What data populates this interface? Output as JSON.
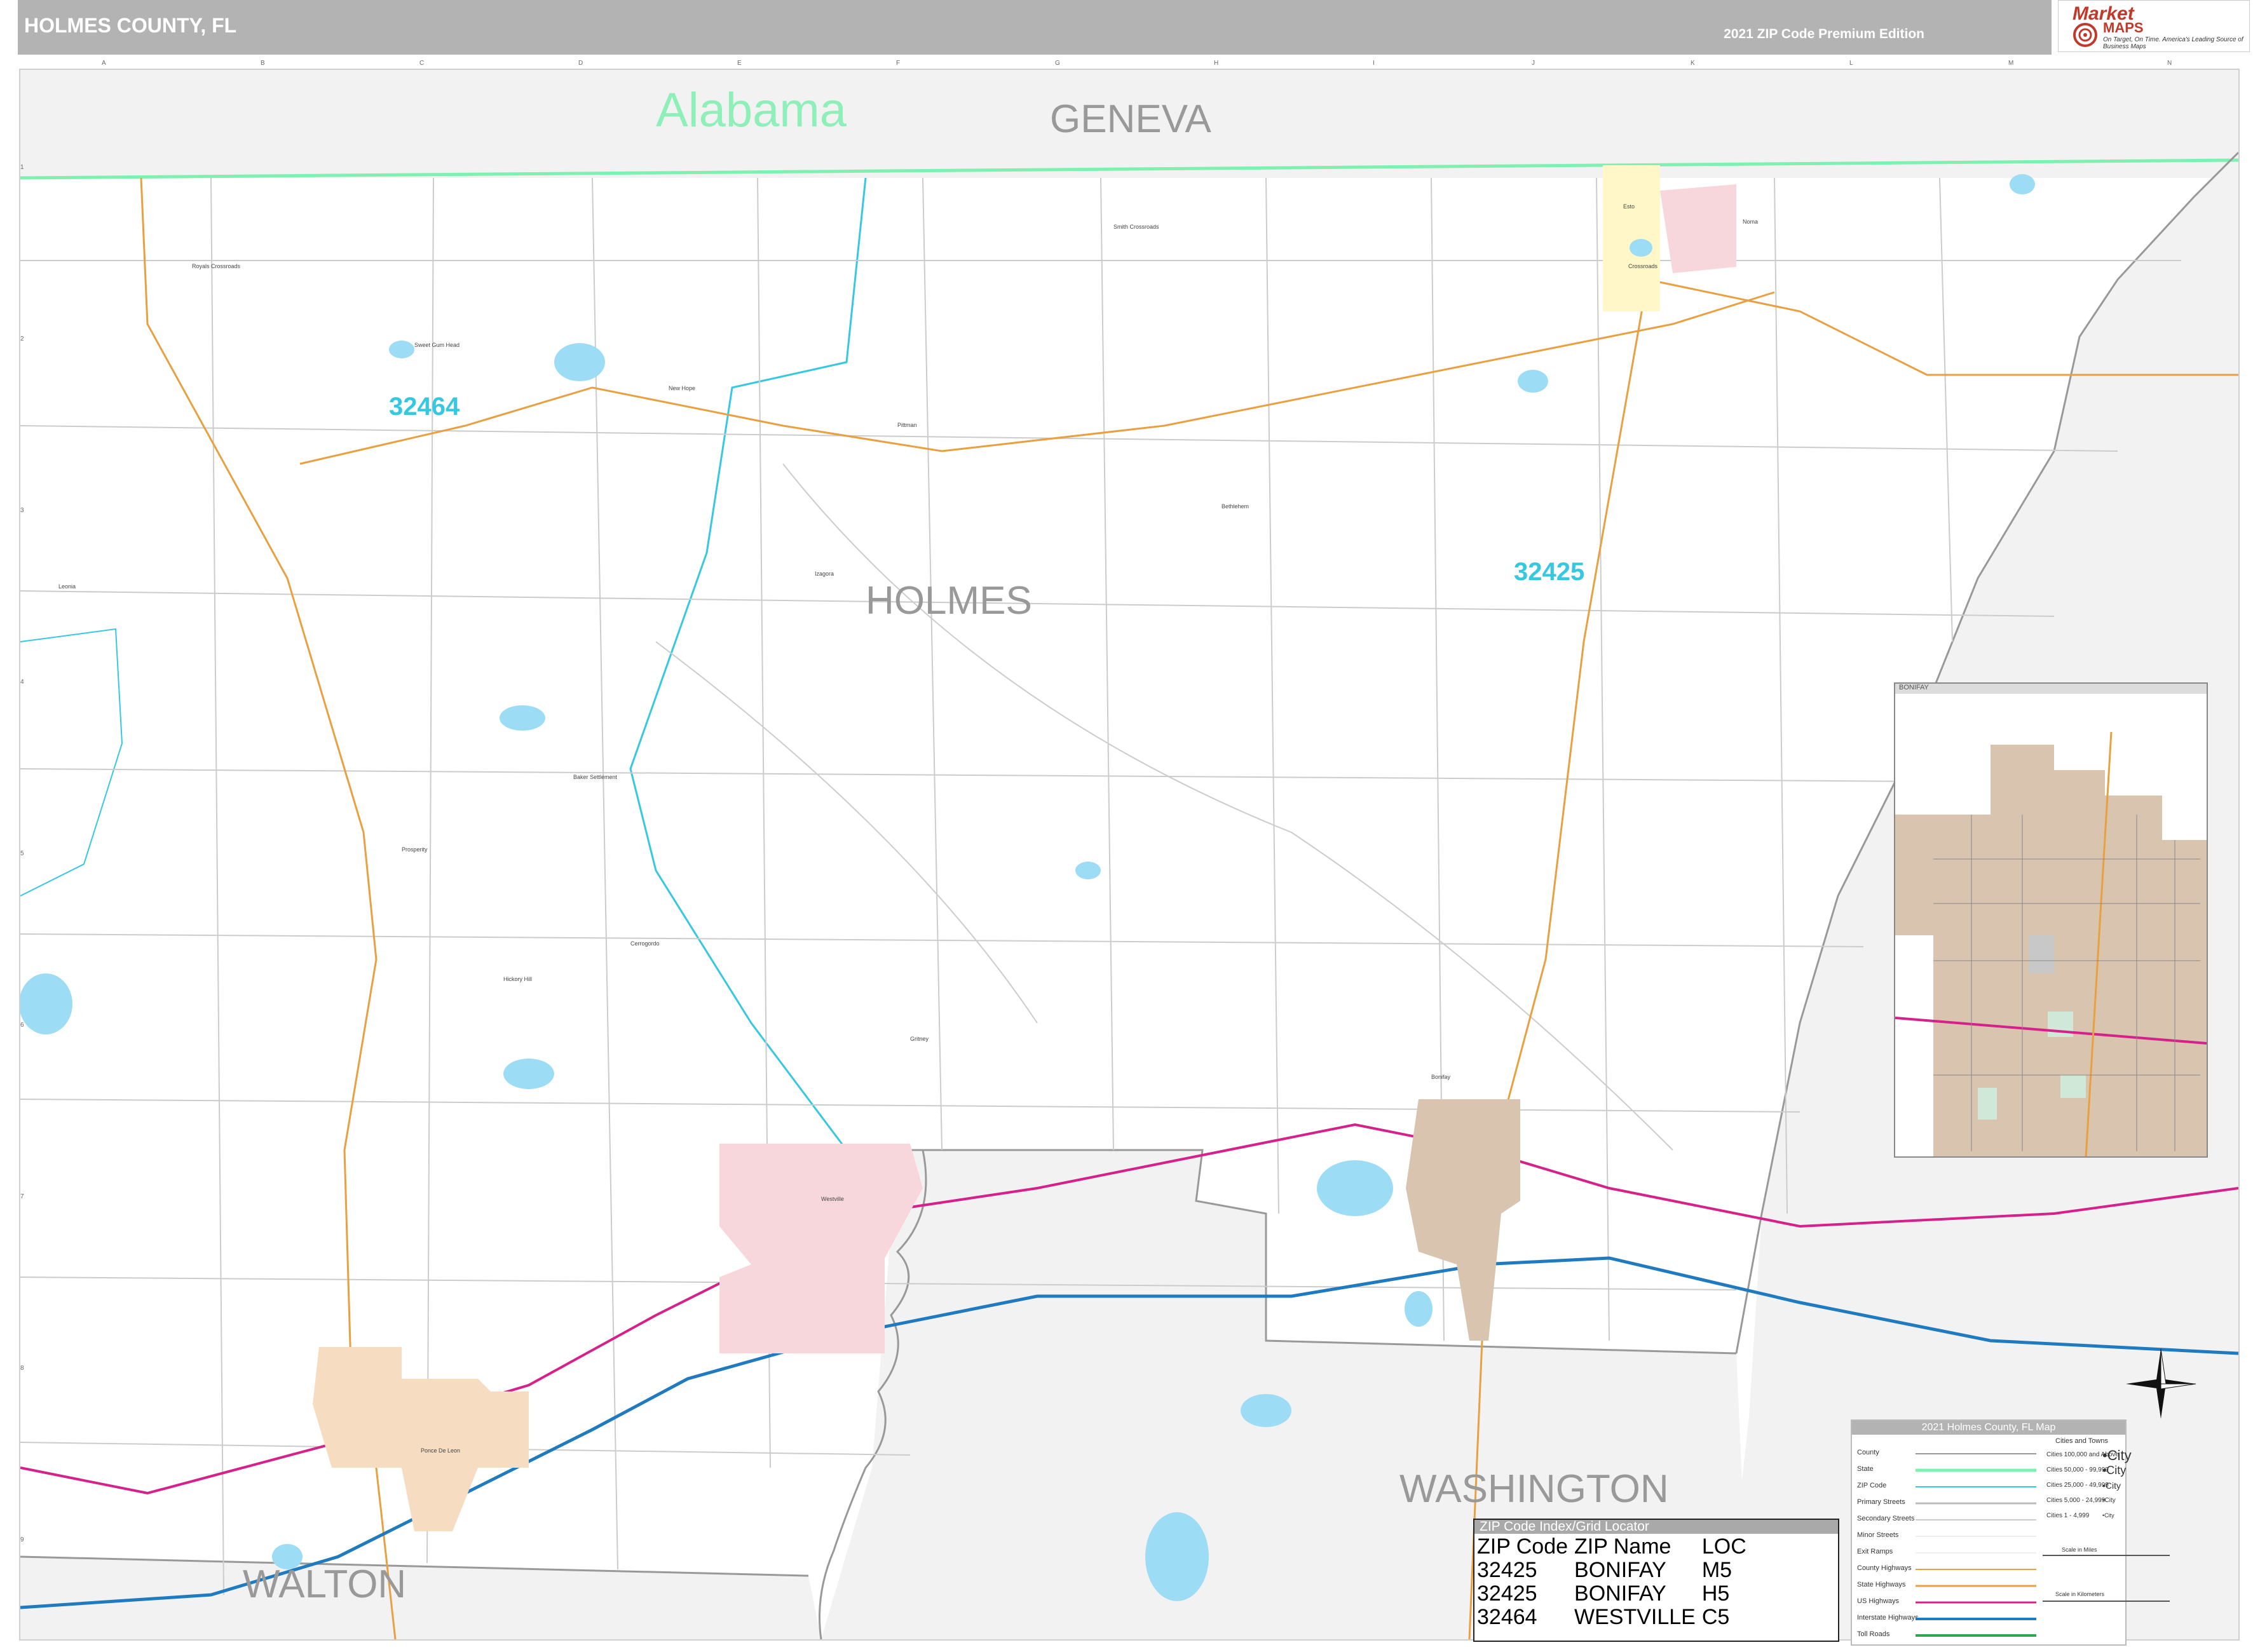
{
  "header": {
    "title": "HOLMES COUNTY, FL",
    "edition": "2021 ZIP Code Premium Edition"
  },
  "logo": {
    "line1": "Market",
    "line2": "MAPS",
    "tagline": "On Target, On Time. America's Leading Source of Business Maps"
  },
  "map": {
    "state_label": "Alabama",
    "county_labels": {
      "geneva": "GENEVA",
      "holmes": "HOLMES",
      "washington": "WASHINGTON",
      "walton": "WALTON"
    },
    "zip_labels": {
      "z32464": "32464",
      "z32425": "32425"
    },
    "towns": [
      "Royals Crossroads",
      "Sweet Gum Head",
      "New Hope",
      "Pittman",
      "Smith Crossroads",
      "Esto",
      "Noma",
      "Leonia",
      "Bethlehem",
      "Bonifay",
      "Baker Settlement",
      "Prosperity",
      "Ponce De Leon",
      "Westville",
      "Cerrogordo",
      "Hickory Hill",
      "Crossroads",
      "Izagora",
      "Gritney"
    ],
    "grid_cols": [
      "A",
      "B",
      "C",
      "D",
      "E",
      "F",
      "G",
      "H",
      "I",
      "J",
      "K",
      "L",
      "M",
      "N"
    ],
    "grid_rows": [
      "1",
      "2",
      "3",
      "4",
      "5",
      "6",
      "7",
      "8",
      "9"
    ],
    "colors": {
      "state_line": "#7ef0b0",
      "zip_line": "#36c8e0",
      "us_highway": "#d6208a",
      "interstate": "#1f7ac0",
      "state_highway": "#e8a040",
      "city": "#d9c4b0",
      "water": "#9ddcf5",
      "outside": "#f2f2f2"
    }
  },
  "inset": {
    "title": "BONIFAY"
  },
  "legend": {
    "title": "2021 Holmes County, FL Map",
    "header_right": "Cities and Towns",
    "items": [
      "County",
      "State",
      "ZIP Code",
      "Primary Streets",
      "Secondary Streets",
      "Minor Streets",
      "Exit Ramps",
      "County Highways",
      "State Highways",
      "US Highways",
      "Interstate Highways",
      "Toll Roads"
    ],
    "cities": [
      "Cities 100,000 and Above",
      "Cities 50,000 - 99,999",
      "Cities 25,000 - 49,999",
      "Cities 5,000 - 24,999",
      "Cities 1 - 4,999"
    ],
    "city_samples": [
      "•City",
      "•City",
      "•City",
      "•City",
      "•City"
    ],
    "scale_miles": "Scale in Miles",
    "scale_km": "Scale in Kilometers"
  },
  "zip_index": {
    "title": "ZIP Code Index/Grid Locator",
    "headers": [
      "ZIP Code",
      "ZIP Name",
      "LOC"
    ],
    "rows": [
      [
        "32425",
        "BONIFAY",
        "M5"
      ],
      [
        "32425",
        "BONIFAY",
        "H5"
      ],
      [
        "32464",
        "WESTVILLE",
        "C5"
      ]
    ]
  }
}
